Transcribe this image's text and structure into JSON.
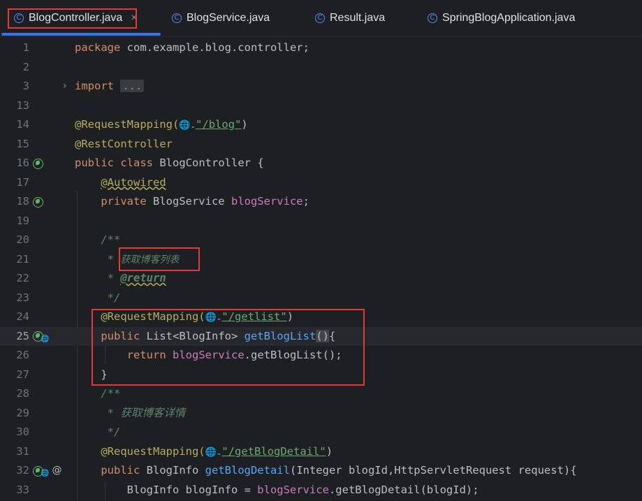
{
  "tabs": [
    {
      "name": "BlogController.java",
      "active": true,
      "close": "×"
    },
    {
      "name": "BlogService.java",
      "active": false
    },
    {
      "name": "Result.java",
      "active": false
    },
    {
      "name": "SpringBlogApplication.java",
      "active": false
    }
  ],
  "tab_icon_letter": "C",
  "line_numbers": [
    "1",
    "2",
    "3",
    "13",
    "14",
    "15",
    "16",
    "17",
    "18",
    "19",
    "20",
    "21",
    "22",
    "23",
    "24",
    "25",
    "26",
    "27",
    "28",
    "29",
    "30",
    "31",
    "32",
    "33"
  ],
  "code": {
    "l1": {
      "kw": "package",
      "rest": " com.example.blog.controller;"
    },
    "l3": {
      "kw": "import",
      "folded": "..."
    },
    "l14": {
      "ann": "@RequestMapping(",
      "str": "\"/blog\"",
      "close": ")"
    },
    "l15": {
      "ann": "@RestController"
    },
    "l16": {
      "kw1": "public",
      "kw2": "class",
      "rest": " BlogController {"
    },
    "l17": {
      "ann": "@Autowired"
    },
    "l18": {
      "kw": "private",
      "type": " BlogService ",
      "field": "blogService",
      "end": ";"
    },
    "l20": {
      "doc": "/**"
    },
    "l21": {
      "star": " * ",
      "text": "获取博客列表"
    },
    "l22": {
      "star": " * ",
      "tag": "@return"
    },
    "l23": {
      "doc": " */"
    },
    "l24": {
      "ann": "@RequestMapping(",
      "str": "\"/getlist\"",
      "close": ")"
    },
    "l25": {
      "kw": "public",
      "type": " List<BlogInfo> ",
      "fn": "getBlogList",
      "parens": "()",
      "end": "{"
    },
    "l26": {
      "kw": "return",
      "field": "blogService",
      "call": ".getBlogList();"
    },
    "l27": {
      "brace": "}"
    },
    "l28": {
      "doc": "/**"
    },
    "l29": {
      "doc": " * 获取博客详情"
    },
    "l30": {
      "doc": " */"
    },
    "l31": {
      "ann": "@RequestMapping(",
      "str": "\"/getBlogDetail\"",
      "close": ")"
    },
    "l32": {
      "kw": "public",
      "type": " BlogInfo ",
      "fn": "getBlogDetail",
      "args": "(Integer blogId,HttpServletRequest request){"
    },
    "l33": {
      "decl": "BlogInfo blogInfo = ",
      "field": "blogService",
      "call": ".getBlogDetail(blogId);"
    }
  },
  "icons": {
    "globe": "🌐",
    "dropdown": "⌄",
    "fold_arrow": "›",
    "at": "@"
  },
  "colors": {
    "keyword": "#cf8e6d",
    "annotation": "#b3ae60",
    "string": "#6aab73",
    "field": "#c77dbb",
    "method": "#56a8f5",
    "doc_comment": "#5f826b",
    "highlight_box": "#e03a3a",
    "tab_underline": "#3574f0"
  }
}
